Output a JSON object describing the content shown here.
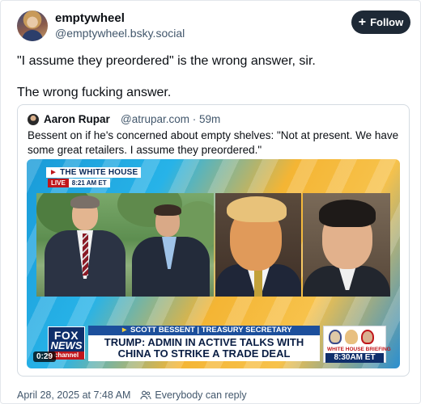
{
  "post": {
    "author": {
      "display_name": "emptywheel",
      "handle": "@emptywheel.bsky.social",
      "avatar": "avatar-image"
    },
    "follow_button": {
      "icon": "plus-icon",
      "label": "Follow"
    },
    "text_lines": [
      "\"I assume they preordered\" is the wrong answer, sir.",
      "The wrong fucking answer."
    ],
    "footer": {
      "timestamp": "April 28, 2025 at 7:48 AM",
      "audience_icon": "people-icon",
      "audience": "Everybody can reply"
    }
  },
  "quote": {
    "author_name": "Aaron Rupar",
    "author_handle_time": "@atrupar.com · 59m",
    "text": "Bessent on if he's concerned about empty shelves: \"Not at present. We have some great retailers. I assume they preordered.\"",
    "video": {
      "duration": "0:29",
      "overlay": {
        "network_top": "THE WHITE HOUSE",
        "live": "LIVE",
        "live_time": "8:21 AM ET",
        "fox_line1": "FOX",
        "fox_line2": "NEWS",
        "fox_line3": "channel",
        "lower_third_name": "SCOTT BESSENT",
        "lower_third_title": "TREASURY SECRETARY",
        "headline_line1": "TRUMP: ADMIN IN ACTIVE TALKS WITH",
        "headline_line2": "CHINA TO STRIKE A TRADE DEAL",
        "briefing_label": "WHITE HOUSE BRIEFING",
        "briefing_time": "8:30AM ET"
      }
    }
  }
}
